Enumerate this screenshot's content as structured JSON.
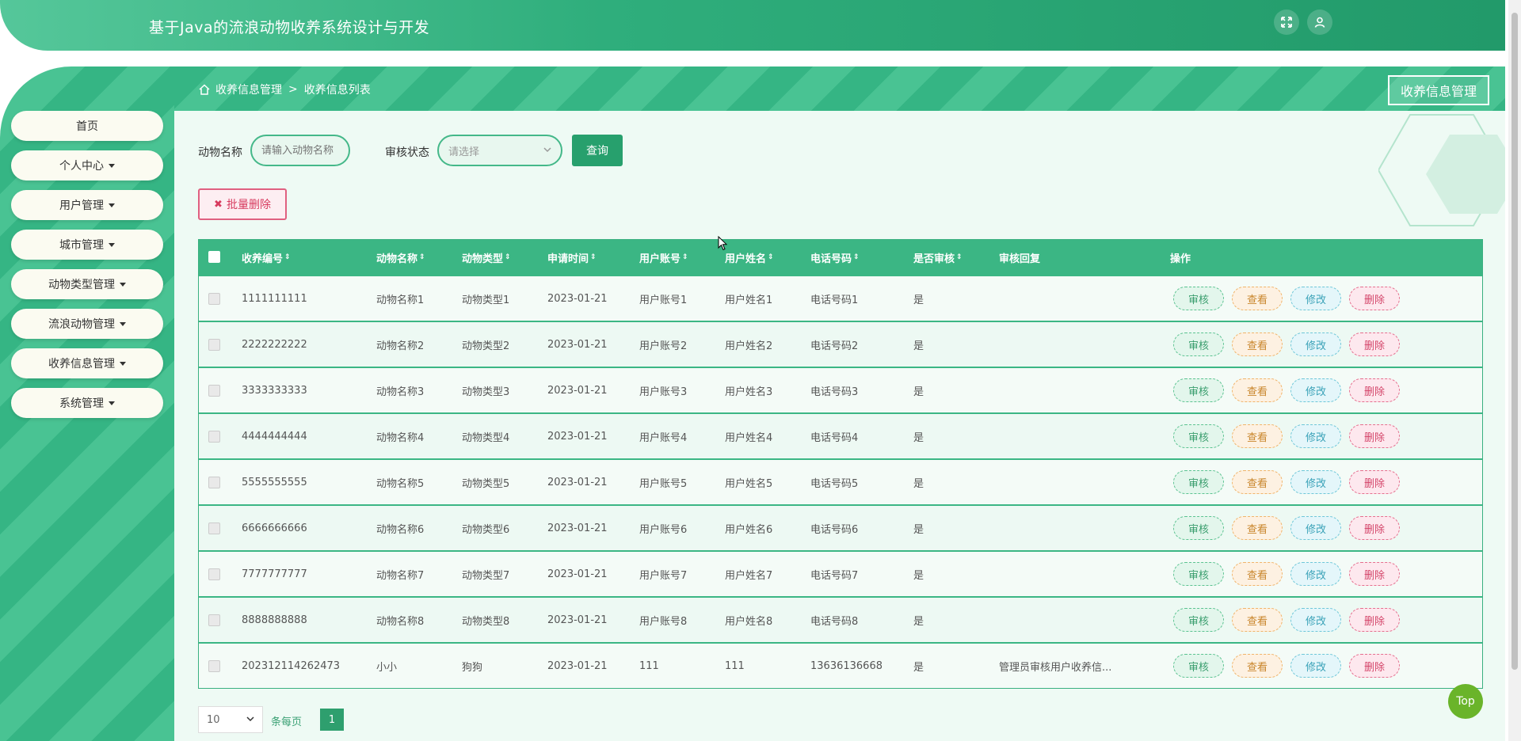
{
  "header": {
    "title": "基于Java的流浪动物收养系统设计与开发"
  },
  "sidebar": {
    "items": [
      {
        "label": "首页",
        "has_caret": false
      },
      {
        "label": "个人中心",
        "has_caret": true
      },
      {
        "label": "用户管理",
        "has_caret": true
      },
      {
        "label": "城市管理",
        "has_caret": true
      },
      {
        "label": "动物类型管理",
        "has_caret": true
      },
      {
        "label": "流浪动物管理",
        "has_caret": true
      },
      {
        "label": "收养信息管理",
        "has_caret": true
      },
      {
        "label": "系统管理",
        "has_caret": true
      }
    ]
  },
  "breadcrumb": {
    "first": "收养信息管理",
    "sep": ">",
    "second": "收养信息列表"
  },
  "page_title_badge": "收养信息管理",
  "filters": {
    "animal_name_label": "动物名称",
    "animal_name_placeholder": "请输入动物名称",
    "status_label": "审核状态",
    "status_placeholder": "请选择",
    "query_label": "查询"
  },
  "batch_delete_label": "批量删除",
  "table": {
    "headers": {
      "adopt_no": "收养编号",
      "animal_name": "动物名称",
      "animal_type": "动物类型",
      "apply_time": "申请时间",
      "user_account": "用户账号",
      "user_name": "用户姓名",
      "phone": "电话号码",
      "reviewed": "是否审核",
      "reply": "审核回复",
      "ops": "操作"
    },
    "sort_glyph": "⇕",
    "ops": {
      "review": "审核",
      "view": "查看",
      "edit": "修改",
      "delete": "删除"
    },
    "rows": [
      {
        "adopt_no": "1111111111",
        "animal_name": "动物名称1",
        "animal_type": "动物类型1",
        "apply_time": "2023-01-21",
        "user_account": "用户账号1",
        "user_name": "用户姓名1",
        "phone": "电话号码1",
        "reviewed": "是",
        "reply": ""
      },
      {
        "adopt_no": "2222222222",
        "animal_name": "动物名称2",
        "animal_type": "动物类型2",
        "apply_time": "2023-01-21",
        "user_account": "用户账号2",
        "user_name": "用户姓名2",
        "phone": "电话号码2",
        "reviewed": "是",
        "reply": ""
      },
      {
        "adopt_no": "3333333333",
        "animal_name": "动物名称3",
        "animal_type": "动物类型3",
        "apply_time": "2023-01-21",
        "user_account": "用户账号3",
        "user_name": "用户姓名3",
        "phone": "电话号码3",
        "reviewed": "是",
        "reply": ""
      },
      {
        "adopt_no": "4444444444",
        "animal_name": "动物名称4",
        "animal_type": "动物类型4",
        "apply_time": "2023-01-21",
        "user_account": "用户账号4",
        "user_name": "用户姓名4",
        "phone": "电话号码4",
        "reviewed": "是",
        "reply": ""
      },
      {
        "adopt_no": "5555555555",
        "animal_name": "动物名称5",
        "animal_type": "动物类型5",
        "apply_time": "2023-01-21",
        "user_account": "用户账号5",
        "user_name": "用户姓名5",
        "phone": "电话号码5",
        "reviewed": "是",
        "reply": ""
      },
      {
        "adopt_no": "6666666666",
        "animal_name": "动物名称6",
        "animal_type": "动物类型6",
        "apply_time": "2023-01-21",
        "user_account": "用户账号6",
        "user_name": "用户姓名6",
        "phone": "电话号码6",
        "reviewed": "是",
        "reply": ""
      },
      {
        "adopt_no": "7777777777",
        "animal_name": "动物名称7",
        "animal_type": "动物类型7",
        "apply_time": "2023-01-21",
        "user_account": "用户账号7",
        "user_name": "用户姓名7",
        "phone": "电话号码7",
        "reviewed": "是",
        "reply": ""
      },
      {
        "adopt_no": "8888888888",
        "animal_name": "动物名称8",
        "animal_type": "动物类型8",
        "apply_time": "2023-01-21",
        "user_account": "用户账号8",
        "user_name": "用户姓名8",
        "phone": "电话号码8",
        "reviewed": "是",
        "reply": ""
      },
      {
        "adopt_no": "202312114262473",
        "animal_name": "小小",
        "animal_type": "狗狗",
        "apply_time": "2023-01-21",
        "user_account": "111",
        "user_name": "111",
        "phone": "13636136668",
        "reviewed": "是",
        "reply": "管理员审核用户收养信..."
      }
    ]
  },
  "pagination": {
    "page_size": "10",
    "per_page_label": "条每页",
    "current_page": "1"
  },
  "top_button": "Top"
}
